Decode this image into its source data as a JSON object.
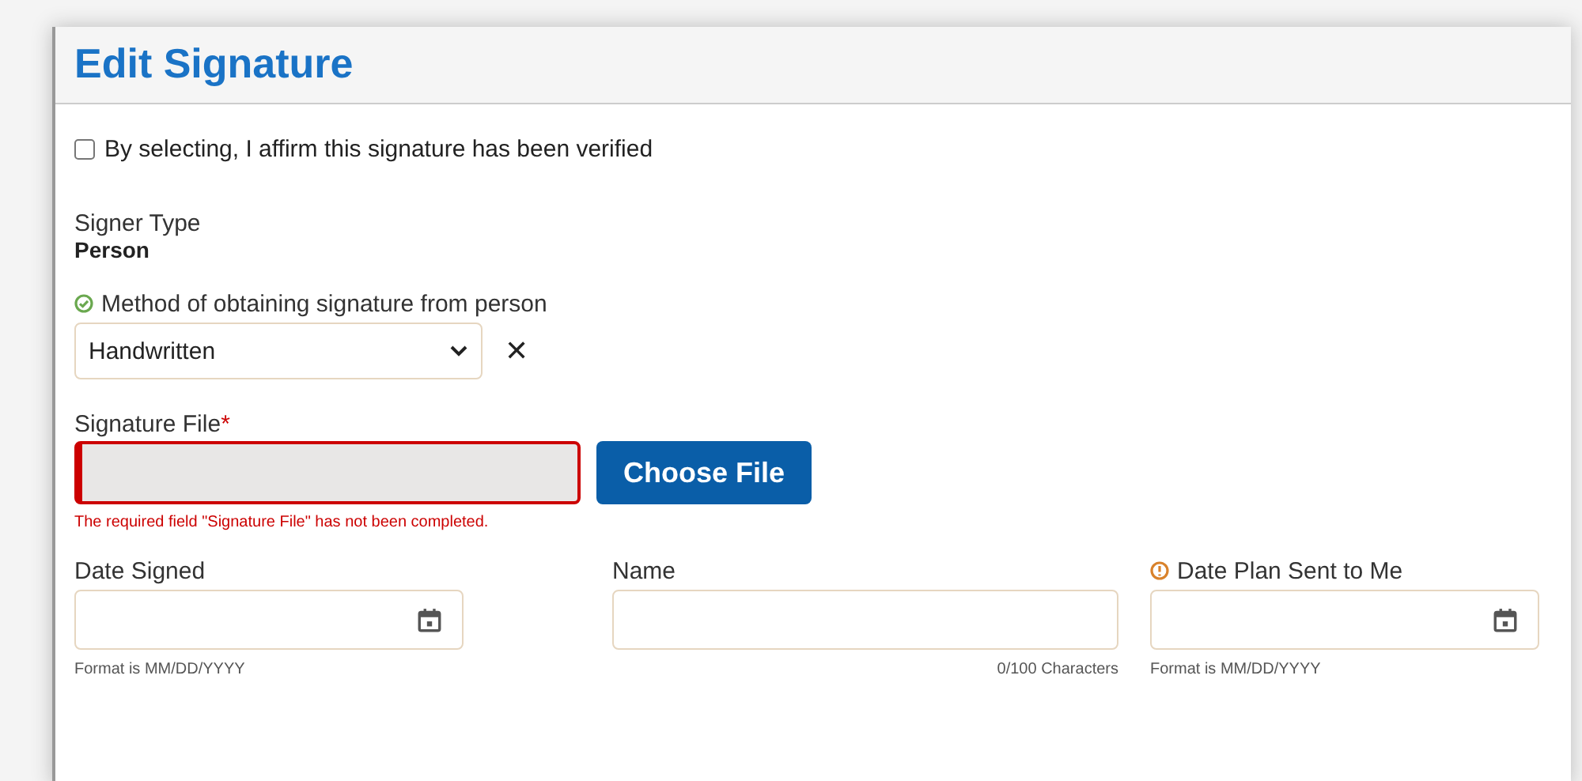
{
  "title": "Edit Signature",
  "verify": {
    "label": "By selecting, I affirm this signature has been verified",
    "checked": false
  },
  "signer_type": {
    "label": "Signer Type",
    "value": "Person"
  },
  "method": {
    "label": "Method of obtaining signature from person",
    "valid": true,
    "value": "Handwritten",
    "clear": "✕"
  },
  "signature_file": {
    "label": "Signature File",
    "required_mark": "*",
    "button": "Choose File",
    "error": "The required field \"Signature File\" has not been completed."
  },
  "fields": [
    {
      "kind": "date",
      "label": "Date Signed",
      "warning": false,
      "hint": "Format is MM/DD/YYYY"
    },
    {
      "kind": "text",
      "label": "Name",
      "warning": false,
      "counter": "0/100 Characters"
    },
    {
      "kind": "date",
      "label": "Date Plan Sent to Me",
      "warning": true,
      "hint": "Format is MM/DD/YYYY"
    }
  ]
}
